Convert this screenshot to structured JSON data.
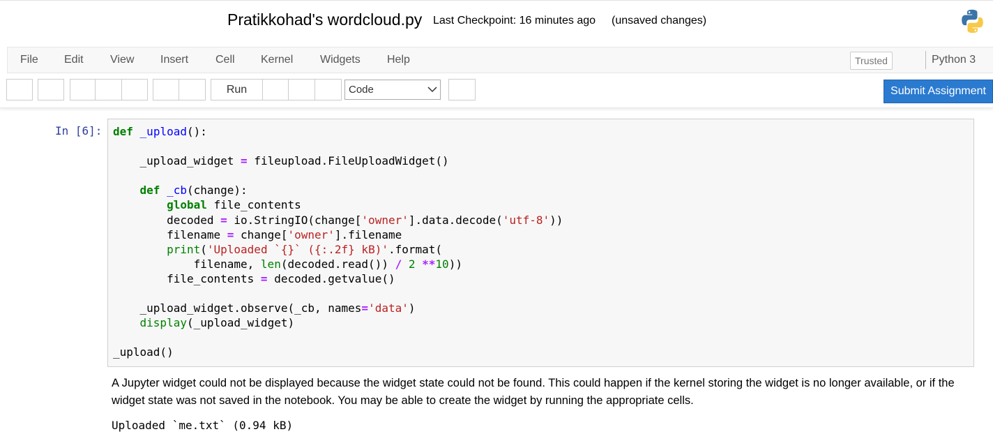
{
  "header": {
    "title": "Pratikkohad's wordcloud.py",
    "checkpoint": "Last Checkpoint: 16 minutes ago",
    "save_status": "(unsaved changes)",
    "logo_icon": "python-logo-icon"
  },
  "menubar": {
    "items": [
      "File",
      "Edit",
      "View",
      "Insert",
      "Cell",
      "Kernel",
      "Widgets",
      "Help"
    ],
    "trusted": "Trusted",
    "kernel": "Python 3"
  },
  "toolbar": {
    "run_label": "Run",
    "cell_type": "Code",
    "submit_label": "Submit Assignment"
  },
  "cell": {
    "prompt": "In [6]:",
    "code_lines": [
      "def _upload():",
      "",
      "    _upload_widget = fileupload.FileUploadWidget()",
      "",
      "    def _cb(change):",
      "        global file_contents",
      "        decoded = io.StringIO(change['owner'].data.decode('utf-8'))",
      "        filename = change['owner'].filename",
      "        print('Uploaded `{}` ({:.2f} kB)'.format(",
      "            filename, len(decoded.read()) / 2 **10))",
      "        file_contents = decoded.getvalue()",
      "",
      "    _upload_widget.observe(_cb, names='data')",
      "    display(_upload_widget)",
      "",
      "_upload()"
    ]
  },
  "output": {
    "widget_error": "A Jupyter widget could not be displayed because the widget state could not be found. This could happen if the kernel storing the widget is no longer available, or if the widget state was not saved in the notebook. You may be able to create the widget by running the appropriate cells.",
    "stream": "Uploaded `me.txt` (0.94 kB)"
  },
  "colors": {
    "submit_bg": "#2a7ad0",
    "prompt": "#303f9f",
    "keyword": "#008000",
    "string": "#ba2121",
    "operator": "#aa22ff"
  }
}
